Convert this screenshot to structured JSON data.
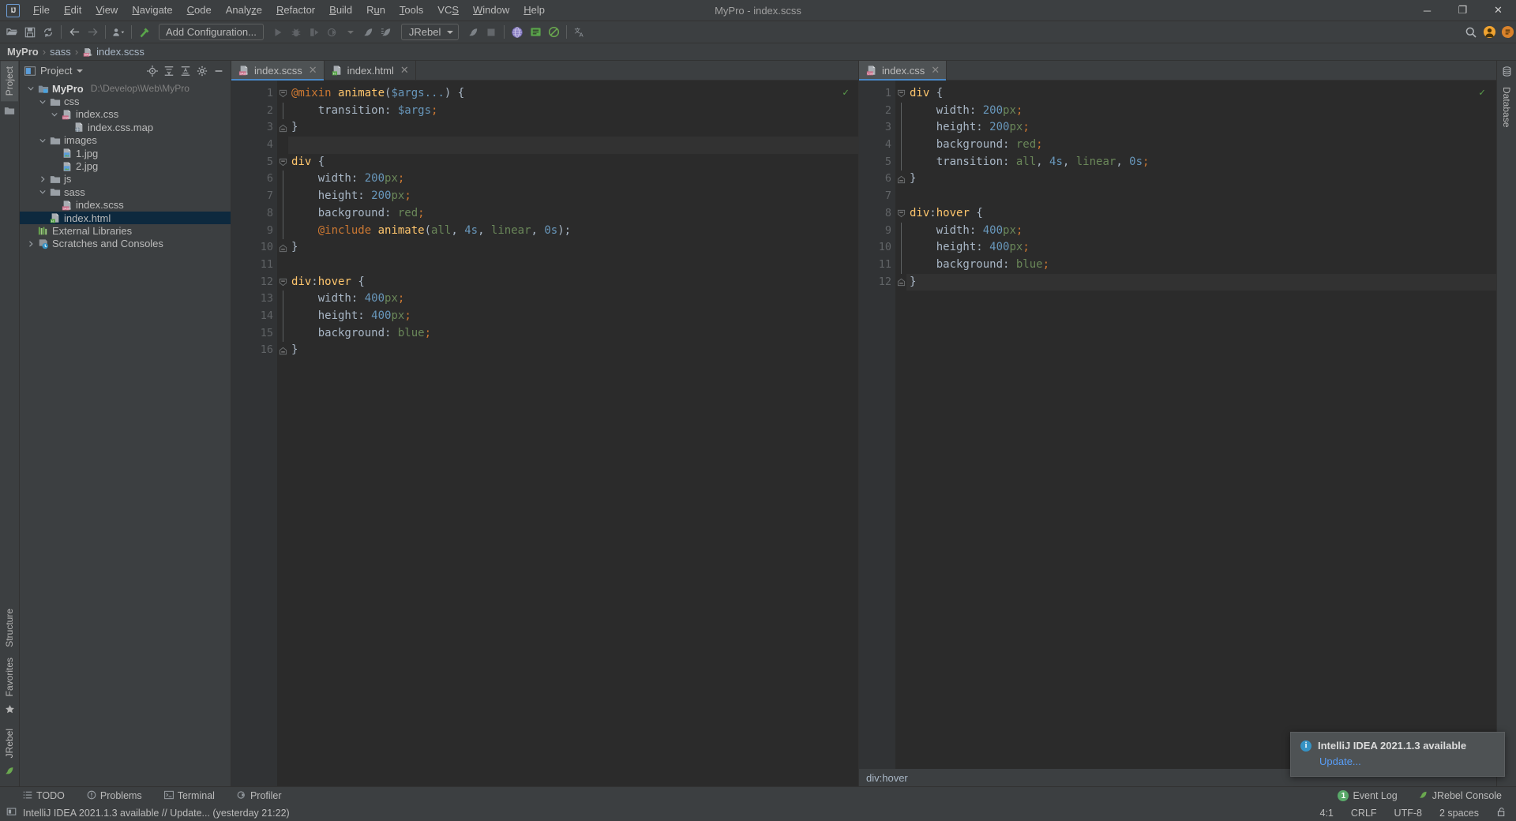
{
  "window": {
    "title": "MyPro - index.scss",
    "logo": "IJ",
    "controls": {
      "minimize": "─",
      "maximize": "❐",
      "close": "✕"
    }
  },
  "menu": [
    {
      "label": "File"
    },
    {
      "label": "Edit"
    },
    {
      "label": "View"
    },
    {
      "label": "Navigate"
    },
    {
      "label": "Code"
    },
    {
      "label": "Analyze"
    },
    {
      "label": "Refactor"
    },
    {
      "label": "Build"
    },
    {
      "label": "Run"
    },
    {
      "label": "Tools"
    },
    {
      "label": "VCS"
    },
    {
      "label": "Window"
    },
    {
      "label": "Help"
    }
  ],
  "toolbar": {
    "run_config_label": "Add Configuration...",
    "jrebel_label": "JRebel",
    "icons": [
      "open-folder-icon",
      "save-icon",
      "sync-icon",
      "back-arrow-icon",
      "forward-arrow-icon",
      "profile-dropdown-icon",
      "build-hammer-icon",
      "run-icon",
      "debug-icon",
      "run-coverage-icon",
      "profile-run-icon",
      "jrebel-run-icon",
      "jrebel-debug-icon",
      "jrebel-run-2-icon",
      "stop-icon",
      "browser-icon",
      "jrebel-panel-icon",
      "no-entry-icon",
      "translate-icon",
      "search-everywhere-icon",
      "account-icon",
      "ide-notification-icon"
    ]
  },
  "breadcrumbs": [
    {
      "label": "MyPro",
      "icon": "project-icon"
    },
    {
      "label": "sass",
      "icon": "folder-icon"
    },
    {
      "label": "index.scss",
      "icon": "scss-file-icon"
    }
  ],
  "left_strip": {
    "top": [
      {
        "label": "Project",
        "active": true,
        "icon": "project-tool-icon"
      }
    ],
    "top_icons": [
      "folder-strip-icon"
    ],
    "bottom": [
      {
        "label": "Structure",
        "icon": "structure-icon"
      },
      {
        "label": "Favorites",
        "icon": "star-icon"
      },
      {
        "label": "JRebel",
        "icon": "jrebel-icon"
      }
    ]
  },
  "right_strip": {
    "items": [
      {
        "label": "Database",
        "icon": "database-icon"
      }
    ]
  },
  "project_panel": {
    "title": "Project",
    "actions": [
      "locate-icon",
      "expand-all-icon",
      "collapse-all-icon",
      "settings-gear-icon",
      "hide-icon"
    ],
    "tree": [
      {
        "depth": 0,
        "arrow": "down",
        "icon": "module-icon",
        "label": "MyPro",
        "bold": true,
        "path": "D:\\Develop\\Web\\MyPro",
        "selected": false
      },
      {
        "depth": 1,
        "arrow": "down",
        "icon": "folder-icon",
        "label": "css",
        "bold": false,
        "path": "",
        "selected": false
      },
      {
        "depth": 2,
        "arrow": "down",
        "icon": "css-file-icon",
        "label": "index.css",
        "bold": false,
        "path": "",
        "selected": false
      },
      {
        "depth": 3,
        "arrow": "none",
        "icon": "map-file-icon",
        "label": "index.css.map",
        "bold": false,
        "path": "",
        "selected": false
      },
      {
        "depth": 1,
        "arrow": "down",
        "icon": "folder-icon",
        "label": "images",
        "bold": false,
        "path": "",
        "selected": false
      },
      {
        "depth": 2,
        "arrow": "none",
        "icon": "image-file-icon",
        "label": "1.jpg",
        "bold": false,
        "path": "",
        "selected": false
      },
      {
        "depth": 2,
        "arrow": "none",
        "icon": "image-file-icon",
        "label": "2.jpg",
        "bold": false,
        "path": "",
        "selected": false
      },
      {
        "depth": 1,
        "arrow": "right",
        "icon": "folder-icon",
        "label": "js",
        "bold": false,
        "path": "",
        "selected": false
      },
      {
        "depth": 1,
        "arrow": "down",
        "icon": "folder-icon",
        "label": "sass",
        "bold": false,
        "path": "",
        "selected": false
      },
      {
        "depth": 2,
        "arrow": "none",
        "icon": "scss-file-icon",
        "label": "index.scss",
        "bold": false,
        "path": "",
        "selected": false
      },
      {
        "depth": 1,
        "arrow": "none",
        "icon": "html-file-icon",
        "label": "index.html",
        "bold": false,
        "path": "",
        "selected": true
      },
      {
        "depth": 0,
        "arrow": "none",
        "icon": "libraries-icon",
        "label": "External Libraries",
        "bold": false,
        "path": "",
        "selected": false
      },
      {
        "depth": 0,
        "arrow": "right",
        "icon": "scratches-icon",
        "label": "Scratches and Consoles",
        "bold": false,
        "path": "",
        "selected": false
      }
    ]
  },
  "editor_left": {
    "tabs": [
      {
        "label": "index.scss",
        "icon": "scss-file-icon",
        "active": true,
        "close": "✕"
      },
      {
        "label": "index.html",
        "icon": "html-file-icon",
        "active": false,
        "close": "✕"
      }
    ],
    "inspection_ok": "✓",
    "lines": [
      {
        "n": 1,
        "fold": "start",
        "marker": null,
        "tokens": [
          {
            "t": "@mixin",
            "c": "k-at"
          },
          {
            "t": " ",
            "c": "k-plain"
          },
          {
            "t": "animate",
            "c": "k-fn"
          },
          {
            "t": "(",
            "c": "k-plain"
          },
          {
            "t": "$args...",
            "c": "k-var"
          },
          {
            "t": ") {",
            "c": "k-plain"
          }
        ]
      },
      {
        "n": 2,
        "fold": "bar",
        "marker": null,
        "tokens": [
          {
            "t": "    transition: ",
            "c": "k-plain"
          },
          {
            "t": "$args",
            "c": "k-var"
          },
          {
            "t": ";",
            "c": "k-semi"
          }
        ]
      },
      {
        "n": 3,
        "fold": "end",
        "marker": null,
        "tokens": [
          {
            "t": "}",
            "c": "k-plain"
          }
        ]
      },
      {
        "n": 4,
        "fold": "none",
        "marker": null,
        "hl": true,
        "tokens": [
          {
            "t": "",
            "c": "k-plain"
          }
        ]
      },
      {
        "n": 5,
        "fold": "start",
        "marker": null,
        "tokens": [
          {
            "t": "div",
            "c": "k-tag"
          },
          {
            "t": " {",
            "c": "k-plain"
          }
        ]
      },
      {
        "n": 6,
        "fold": "bar",
        "marker": null,
        "tokens": [
          {
            "t": "    width: ",
            "c": "k-plain"
          },
          {
            "t": "200",
            "c": "k-num"
          },
          {
            "t": "px",
            "c": "k-unit"
          },
          {
            "t": ";",
            "c": "k-semi"
          }
        ]
      },
      {
        "n": 7,
        "fold": "bar",
        "marker": null,
        "tokens": [
          {
            "t": "    height: ",
            "c": "k-plain"
          },
          {
            "t": "200",
            "c": "k-num"
          },
          {
            "t": "px",
            "c": "k-unit"
          },
          {
            "t": ";",
            "c": "k-semi"
          }
        ]
      },
      {
        "n": 8,
        "fold": "bar",
        "marker": "#ff0000",
        "tokens": [
          {
            "t": "    background: ",
            "c": "k-plain"
          },
          {
            "t": "red",
            "c": "k-val"
          },
          {
            "t": ";",
            "c": "k-semi"
          }
        ]
      },
      {
        "n": 9,
        "fold": "bar",
        "marker": null,
        "tokens": [
          {
            "t": "    ",
            "c": "k-plain"
          },
          {
            "t": "@include",
            "c": "k-at"
          },
          {
            "t": " ",
            "c": "k-plain"
          },
          {
            "t": "animate",
            "c": "k-fn"
          },
          {
            "t": "(",
            "c": "k-plain"
          },
          {
            "t": "all",
            "c": "k-val"
          },
          {
            "t": ", ",
            "c": "k-plain"
          },
          {
            "t": "4s",
            "c": "k-num"
          },
          {
            "t": ", ",
            "c": "k-plain"
          },
          {
            "t": "linear",
            "c": "k-val"
          },
          {
            "t": ", ",
            "c": "k-plain"
          },
          {
            "t": "0s",
            "c": "k-num"
          },
          {
            "t": ");",
            "c": "k-plain"
          }
        ]
      },
      {
        "n": 10,
        "fold": "end",
        "marker": null,
        "tokens": [
          {
            "t": "}",
            "c": "k-plain"
          }
        ]
      },
      {
        "n": 11,
        "fold": "none",
        "marker": null,
        "tokens": [
          {
            "t": "",
            "c": "k-plain"
          }
        ]
      },
      {
        "n": 12,
        "fold": "start",
        "marker": null,
        "tokens": [
          {
            "t": "div",
            "c": "k-tag"
          },
          {
            "t": ":",
            "c": "k-plain"
          },
          {
            "t": "hover",
            "c": "k-tag"
          },
          {
            "t": " {",
            "c": "k-plain"
          }
        ]
      },
      {
        "n": 13,
        "fold": "bar",
        "marker": null,
        "tokens": [
          {
            "t": "    width: ",
            "c": "k-plain"
          },
          {
            "t": "400",
            "c": "k-num"
          },
          {
            "t": "px",
            "c": "k-unit"
          },
          {
            "t": ";",
            "c": "k-semi"
          }
        ]
      },
      {
        "n": 14,
        "fold": "bar",
        "marker": null,
        "tokens": [
          {
            "t": "    height: ",
            "c": "k-plain"
          },
          {
            "t": "400",
            "c": "k-num"
          },
          {
            "t": "px",
            "c": "k-unit"
          },
          {
            "t": ";",
            "c": "k-semi"
          }
        ]
      },
      {
        "n": 15,
        "fold": "bar",
        "marker": "#0000ff",
        "tokens": [
          {
            "t": "    background: ",
            "c": "k-plain"
          },
          {
            "t": "blue",
            "c": "k-val"
          },
          {
            "t": ";",
            "c": "k-semi"
          }
        ]
      },
      {
        "n": 16,
        "fold": "end",
        "marker": null,
        "tokens": [
          {
            "t": "}",
            "c": "k-plain"
          }
        ]
      }
    ]
  },
  "editor_right": {
    "tabs": [
      {
        "label": "index.css",
        "icon": "css-file-icon",
        "active": true,
        "close": "✕"
      }
    ],
    "inspection_ok": "✓",
    "status_text": "div:hover",
    "lines": [
      {
        "n": 1,
        "fold": "start",
        "marker": null,
        "tokens": [
          {
            "t": "div",
            "c": "k-tag"
          },
          {
            "t": " {",
            "c": "k-plain"
          }
        ]
      },
      {
        "n": 2,
        "fold": "bar",
        "marker": null,
        "tokens": [
          {
            "t": "    width: ",
            "c": "k-plain"
          },
          {
            "t": "200",
            "c": "k-num"
          },
          {
            "t": "px",
            "c": "k-unit"
          },
          {
            "t": ";",
            "c": "k-semi"
          }
        ]
      },
      {
        "n": 3,
        "fold": "bar",
        "marker": null,
        "tokens": [
          {
            "t": "    height: ",
            "c": "k-plain"
          },
          {
            "t": "200",
            "c": "k-num"
          },
          {
            "t": "px",
            "c": "k-unit"
          },
          {
            "t": ";",
            "c": "k-semi"
          }
        ]
      },
      {
        "n": 4,
        "fold": "bar",
        "marker": "#ff0000",
        "tokens": [
          {
            "t": "    background: ",
            "c": "k-plain"
          },
          {
            "t": "red",
            "c": "k-val"
          },
          {
            "t": ";",
            "c": "k-semi"
          }
        ]
      },
      {
        "n": 5,
        "fold": "bar",
        "marker": null,
        "tokens": [
          {
            "t": "    transition: ",
            "c": "k-plain"
          },
          {
            "t": "all",
            "c": "k-val"
          },
          {
            "t": ", ",
            "c": "k-plain"
          },
          {
            "t": "4s",
            "c": "k-num"
          },
          {
            "t": ", ",
            "c": "k-plain"
          },
          {
            "t": "linear",
            "c": "k-val"
          },
          {
            "t": ", ",
            "c": "k-plain"
          },
          {
            "t": "0s",
            "c": "k-num"
          },
          {
            "t": ";",
            "c": "k-semi"
          }
        ]
      },
      {
        "n": 6,
        "fold": "end",
        "marker": null,
        "tokens": [
          {
            "t": "}",
            "c": "k-plain"
          }
        ]
      },
      {
        "n": 7,
        "fold": "none",
        "marker": null,
        "tokens": [
          {
            "t": "",
            "c": "k-plain"
          }
        ]
      },
      {
        "n": 8,
        "fold": "start",
        "marker": null,
        "tokens": [
          {
            "t": "div",
            "c": "k-tag"
          },
          {
            "t": ":",
            "c": "k-plain"
          },
          {
            "t": "hover",
            "c": "k-tag"
          },
          {
            "t": " {",
            "c": "k-plain"
          }
        ]
      },
      {
        "n": 9,
        "fold": "bar",
        "marker": null,
        "tokens": [
          {
            "t": "    width: ",
            "c": "k-plain"
          },
          {
            "t": "400",
            "c": "k-num"
          },
          {
            "t": "px",
            "c": "k-unit"
          },
          {
            "t": ";",
            "c": "k-semi"
          }
        ]
      },
      {
        "n": 10,
        "fold": "bar",
        "marker": null,
        "tokens": [
          {
            "t": "    height: ",
            "c": "k-plain"
          },
          {
            "t": "400",
            "c": "k-num"
          },
          {
            "t": "px",
            "c": "k-unit"
          },
          {
            "t": ";",
            "c": "k-semi"
          }
        ]
      },
      {
        "n": 11,
        "fold": "bar",
        "marker": "#0000ff",
        "tokens": [
          {
            "t": "    background: ",
            "c": "k-plain"
          },
          {
            "t": "blue",
            "c": "k-val"
          },
          {
            "t": ";",
            "c": "k-semi"
          }
        ]
      },
      {
        "n": 12,
        "fold": "end",
        "marker": null,
        "hl": true,
        "tokens": [
          {
            "t": "}",
            "c": "k-plain"
          }
        ]
      }
    ]
  },
  "notification": {
    "title": "IntelliJ IDEA 2021.1.3 available",
    "link": "Update...",
    "icon": "info-icon"
  },
  "bottom_bar": {
    "items": [
      {
        "label": "TODO",
        "icon": "todo-icon"
      },
      {
        "label": "Problems",
        "icon": "problems-icon"
      },
      {
        "label": "Terminal",
        "icon": "terminal-icon"
      },
      {
        "label": "Profiler",
        "icon": "profiler-icon"
      }
    ],
    "right_items": [
      {
        "label": "Event Log",
        "icon": "event-log-icon",
        "badge": "1"
      },
      {
        "label": "JRebel Console",
        "icon": "jrebel-icon"
      }
    ]
  },
  "status_bar": {
    "message": "IntelliJ IDEA 2021.1.3 available // Update... (yesterday 21:22)",
    "message_icon": "balloon-icon",
    "caret": "4:1",
    "line_sep": "CRLF",
    "encoding": "UTF-8",
    "indent": "2 spaces",
    "lock_icon": "unlock-icon"
  },
  "colors": {
    "accent": "#4a88c7",
    "selection": "#0d293e",
    "editor_bg": "#2b2b2b",
    "panel_bg": "#3c3f41",
    "link": "#589df6"
  }
}
